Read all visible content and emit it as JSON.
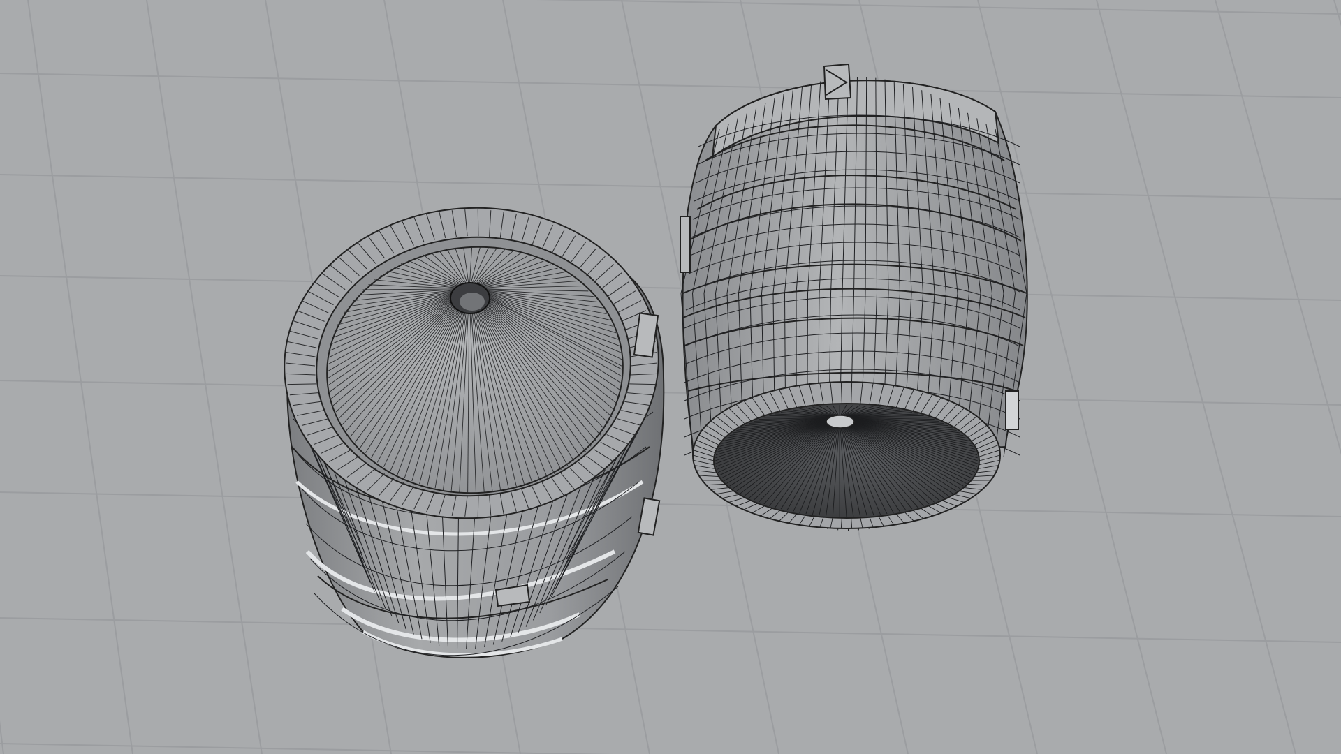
{
  "scene": {
    "background_color": "#a9abad",
    "grid_line_color": "#9b9da0",
    "mesh_fill_color": "#9fa1a3",
    "mesh_dark_color": "#5e6063",
    "wire_color": "#1f2023",
    "highlight_color": "#e4e6e8",
    "objects": [
      "barrel-mesh",
      "barrel-mesh"
    ]
  }
}
